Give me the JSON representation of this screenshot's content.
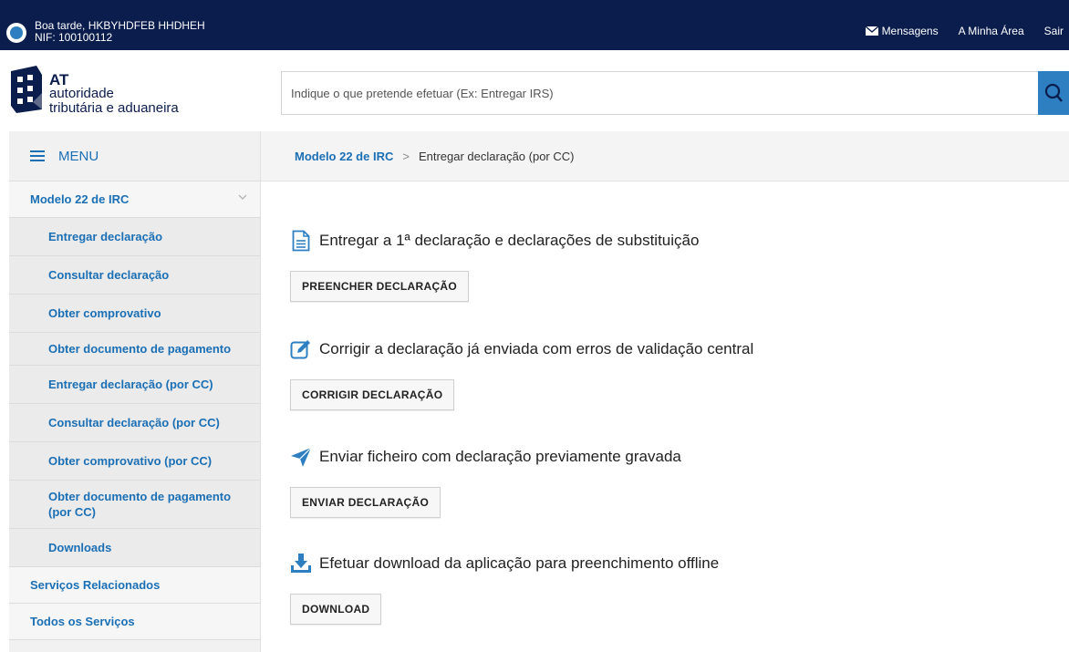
{
  "topbar": {
    "greeting": "Boa tarde, HKBYHDFEB HHDHEH",
    "nif": "NIF: 100100112",
    "links": [
      "Mensagens",
      "A Minha Área",
      "Sair"
    ]
  },
  "header": {
    "logo": {
      "at": "AT",
      "line1": "autoridade",
      "line2": "tributária e aduaneira"
    },
    "search_placeholder": "Indique o que pretende efetuar (Ex: Entregar IRS)"
  },
  "menu": {
    "label": "MENU",
    "parent": "Modelo 22 de IRC",
    "items": [
      "Entregar declaração",
      "Consultar declaração",
      "Obter comprovativo",
      "Obter documento de pagamento",
      "Entregar declaração (por CC)",
      "Consultar declaração (por CC)",
      "Obter comprovativo (por CC)",
      "Obter documento de pagamento (por CC)",
      "Downloads"
    ],
    "related": "Serviços Relacionados",
    "all": "Todos os Serviços"
  },
  "breadcrumb": {
    "parent": "Modelo 22 de IRC",
    "separator": ">",
    "current": "Entregar declaração (por CC)"
  },
  "sections": [
    {
      "icon": "document-icon",
      "title": "Entregar a 1ª declaração e declarações de substituição",
      "button": "PREENCHER DECLARAÇÃO"
    },
    {
      "icon": "edit-icon",
      "title": "Corrigir a declaração já enviada com erros de validação central",
      "button": "CORRIGIR DECLARAÇÃO"
    },
    {
      "icon": "paper-plane-icon",
      "title": "Enviar ficheiro com declaração previamente gravada",
      "button": "ENVIAR DECLARAÇÃO"
    },
    {
      "icon": "download-icon",
      "title": "Efetuar download da aplicação para preenchimento offline",
      "button": "DOWNLOAD"
    }
  ],
  "colors": {
    "topbar": "#0b1d4d",
    "accent": "#1a6fb5",
    "icon_blue": "#2d7fc1"
  }
}
